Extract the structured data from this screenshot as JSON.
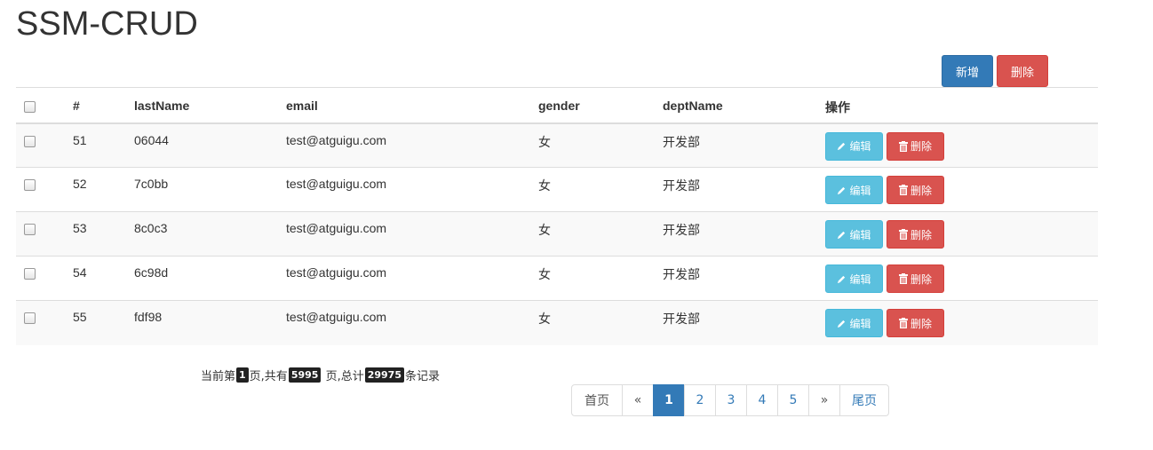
{
  "title": "SSM-CRUD",
  "toolbar": {
    "add_label": "新增",
    "delete_label": "删除"
  },
  "table": {
    "headers": {
      "id": "#",
      "last_name": "lastName",
      "email": "email",
      "gender": "gender",
      "dept": "deptName",
      "ops": "操作"
    },
    "rows": [
      {
        "id": "51",
        "last_name": "06044",
        "email": "test@atguigu.com",
        "gender": "女",
        "dept": "开发部"
      },
      {
        "id": "52",
        "last_name": "7c0bb",
        "email": "test@atguigu.com",
        "gender": "女",
        "dept": "开发部"
      },
      {
        "id": "53",
        "last_name": "8c0c3",
        "email": "test@atguigu.com",
        "gender": "女",
        "dept": "开发部"
      },
      {
        "id": "54",
        "last_name": "6c98d",
        "email": "test@atguigu.com",
        "gender": "女",
        "dept": "开发部"
      },
      {
        "id": "55",
        "last_name": "fdf98",
        "email": "test@atguigu.com",
        "gender": "女",
        "dept": "开发部"
      }
    ],
    "row_actions": {
      "edit_label": "编辑",
      "delete_label": "删除",
      "edit_icon": "pencil-icon",
      "delete_icon": "trash-icon"
    }
  },
  "page_info": {
    "prefix": "当前第",
    "current": "1",
    "mid1": "页,共有",
    "total_pages": "5995",
    "mid2": " 页,总计",
    "total_records": "29975",
    "suffix": "条记录"
  },
  "pagination": {
    "first": "首页",
    "prev": "«",
    "pages": [
      "1",
      "2",
      "3",
      "4",
      "5"
    ],
    "active": "1",
    "next": "»",
    "last": "尾页"
  },
  "colors": {
    "primary": "#337ab7",
    "danger": "#d9534f",
    "info": "#5bc0de",
    "badge": "#222222"
  }
}
